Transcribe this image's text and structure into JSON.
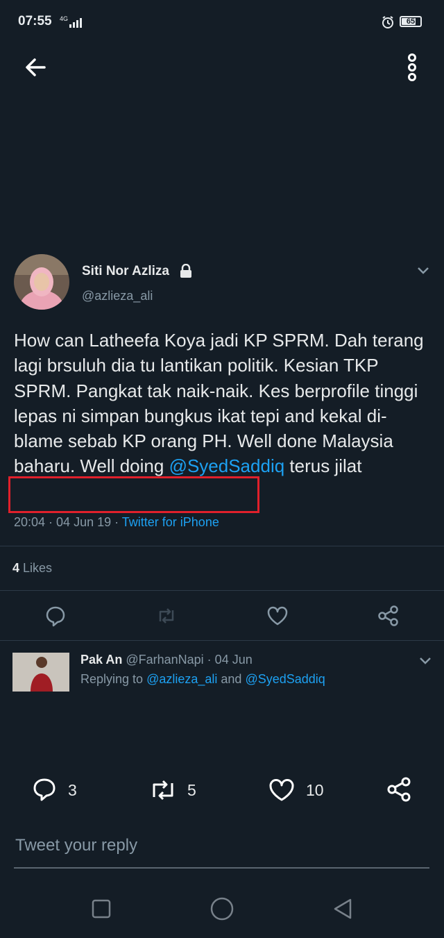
{
  "status": {
    "time": "07:55",
    "network": "4G",
    "battery": "65"
  },
  "tweet": {
    "name": "Siti Nor Azliza",
    "handle": "@azlieza_ali",
    "text_before": "How can Latheefa Koya jadi KP SPRM. Dah terang lagi brsuluh dia tu lantikan politik. Kesian TKP SPRM. Pangkat tak naik-naik. Kes berprofile tinggi lepas ni simpan bungkus ikat tepi and kekal di-blame sebab KP orang PH. Well done Malaysia baharu. Well doing ",
    "mention": "@SyedSaddiq",
    "text_after": " terus jilat",
    "time": "20:04 · 04 Jun 19 · ",
    "source": "Twitter for iPhone",
    "likes_count": "4",
    "likes_label": " Likes"
  },
  "reply": {
    "name": "Pak An",
    "meta": " @FarhanNapi · 04 Jun",
    "replying_prefix": "Replying to ",
    "mention1": "@azlieza_ali",
    "and": " and ",
    "mention2": "@SyedSaddiq"
  },
  "counts": {
    "replies": "3",
    "retweets": "5",
    "likes": "10"
  },
  "compose": {
    "placeholder": "Tweet your reply"
  },
  "icons": {
    "back": "arrow-left-icon",
    "more": "more-vertical-icon",
    "reply": "comment-icon",
    "retweet": "retweet-icon",
    "like": "heart-icon",
    "share": "share-icon"
  }
}
